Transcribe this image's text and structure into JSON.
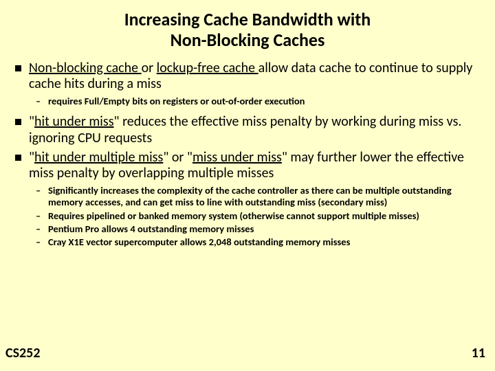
{
  "title_line1": "Increasing Cache Bandwidth with",
  "title_line2": "Non-Blocking Caches",
  "bullets": [
    {
      "parts": [
        {
          "text": "Non-blocking cache ",
          "u": true
        },
        {
          "text": "or  "
        },
        {
          "text": "lockup-free cache ",
          "u": true
        },
        {
          "text": "allow data cache to continue to supply cache hits during a miss"
        }
      ],
      "subs": [
        "requires Full/Empty bits on registers or out-of-order execution"
      ]
    },
    {
      "parts": [
        {
          "text": "\""
        },
        {
          "text": "hit under miss",
          "u": true
        },
        {
          "text": "\"  reduces the effective miss penalty by working during miss vs. ignoring CPU requests"
        }
      ],
      "subs": []
    },
    {
      "parts": [
        {
          "text": "\""
        },
        {
          "text": "hit under multiple miss",
          "u": true
        },
        {
          "text": "\" or \""
        },
        {
          "text": "miss under miss",
          "u": true
        },
        {
          "text": "\"  may further lower the effective miss penalty by overlapping multiple misses"
        }
      ],
      "subs": [
        "Significantly increases the complexity of the cache controller as there can be multiple outstanding memory accesses, and can get miss to line with outstanding miss (secondary miss)",
        "Requires pipelined or banked memory system (otherwise cannot support multiple misses)",
        "Pentium Pro allows 4 outstanding memory misses",
        "Cray X1E vector supercomputer allows 2,048 outstanding memory misses"
      ]
    }
  ],
  "footer_left": "CS252",
  "footer_right": "11"
}
